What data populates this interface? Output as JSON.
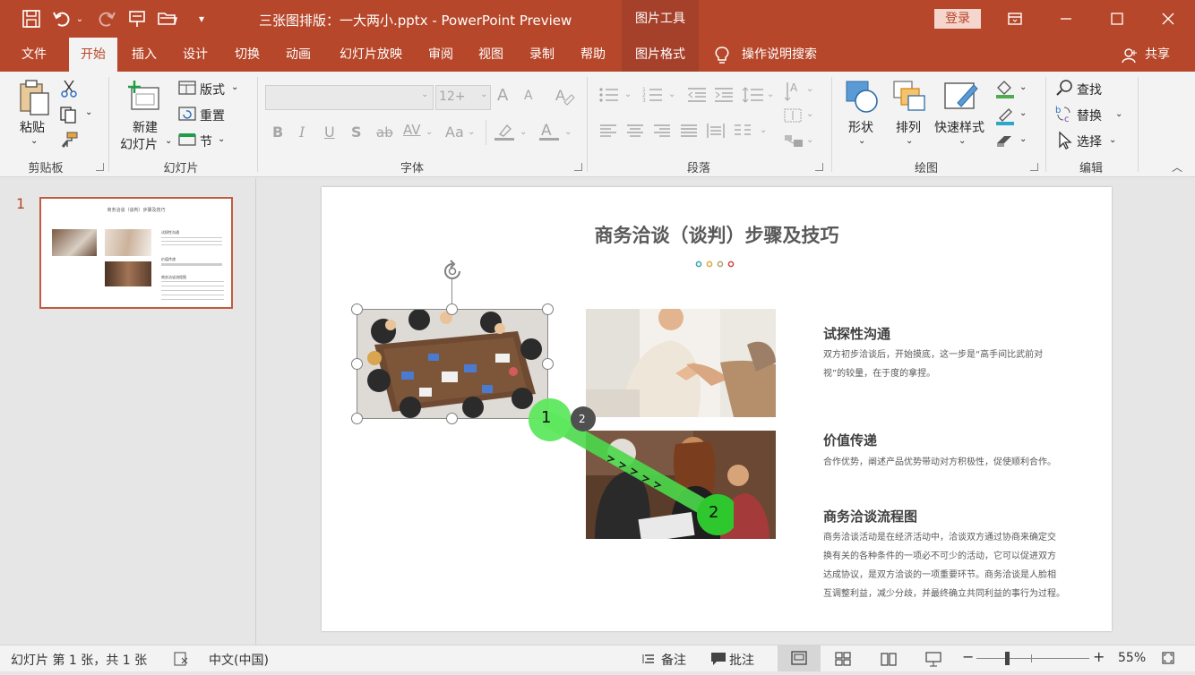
{
  "titlebar": {
    "doc_title": "三张图排版：一大两小.pptx  -  PowerPoint Preview",
    "tools_tab": "图片工具",
    "login": "登录"
  },
  "tabs": [
    "文件",
    "开始",
    "插入",
    "设计",
    "切换",
    "动画",
    "幻灯片放映",
    "审阅",
    "视图",
    "录制",
    "帮助",
    "图片格式",
    "操作说明搜索",
    "共享"
  ],
  "ribbon": {
    "clipboard": {
      "paste": "粘贴",
      "label": "剪贴板"
    },
    "slides": {
      "new_line1": "新建",
      "new_line2": "幻灯片",
      "layout": "版式",
      "reset": "重置",
      "section": "节",
      "label": "幻灯片"
    },
    "font": {
      "size": "12+",
      "label": "字体",
      "bold": "B",
      "italic": "I",
      "underline": "U",
      "strike": "S",
      "strike2": "ab",
      "spacing": "AV",
      "case": "Aa",
      "grow": "A",
      "shrink": "A"
    },
    "paragraph": {
      "label": "段落"
    },
    "drawing": {
      "shapes": "形状",
      "arrange": "排列",
      "quick_styles": "快速样式",
      "label": "绘图"
    },
    "editing": {
      "find": "查找",
      "replace": "替换",
      "select": "选择",
      "label": "编辑"
    }
  },
  "thumbnail": {
    "number": "1",
    "title": "商务洽谈（谈判）步骤及技巧",
    "h1": "试探性沟通",
    "h2": "价值传递",
    "h3": "商务洽谈流程图"
  },
  "slide": {
    "title": "商务洽谈（谈判）步骤及技巧",
    "dots": [
      "#3aa3a8",
      "#e0a33b",
      "#b2a268",
      "#c8453c"
    ],
    "sections": [
      {
        "heading": "试探性沟通",
        "lines": [
          "双方初步洽谈后，开始摸底，这一步是“高手间比武前对",
          "视”的较量，在于度的拿捏。"
        ]
      },
      {
        "heading": "价值传递",
        "lines": [
          "合作优势，阐述产品优势带动对方积极性，促使顺利合作。"
        ]
      },
      {
        "heading": "商务洽谈流程图",
        "lines": [
          "商务洽谈活动是在经济活动中，洽谈双方通过协商来确定交",
          "换有关的各种条件的一项必不可少的活动，它可以促进双方",
          "达成协议，是双方洽谈的一项重要环节。商务洽谈是人脸相",
          "互调整利益，减少分歧，并最终确立共同利益的事行为过程。"
        ]
      }
    ],
    "gesture": {
      "start": "1",
      "end": "2",
      "badge": "2"
    }
  },
  "status": {
    "slide_info": "幻灯片 第 1 张，共 1 张",
    "language": "中文(中国)",
    "notes": "备注",
    "comments": "批注",
    "zoom": "55%"
  },
  "icons": [
    "save-icon",
    "undo-icon",
    "redo-icon",
    "pin-icon",
    "open-icon",
    "customize-icon",
    "ribbon-display-icon",
    "minimize-icon",
    "maximize-icon",
    "close-icon",
    "lightbulb-icon",
    "person-icon",
    "cut-icon",
    "copy-icon",
    "format-painter-icon",
    "rotate-handle-icon",
    "zoom-slider-icon",
    "fit-slide-icon"
  ]
}
